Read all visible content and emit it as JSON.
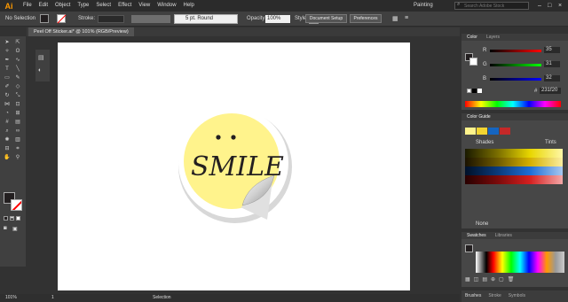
{
  "app": {
    "logo": "Ai",
    "workspace": "Painting",
    "search_placeholder": "Search Adobe Stock"
  },
  "menu": [
    "File",
    "Edit",
    "Object",
    "Type",
    "Select",
    "Effect",
    "View",
    "Window",
    "Help"
  ],
  "control": {
    "selection": "No Selection",
    "stroke_label": "Stroke:",
    "brush": "5 pt. Round",
    "opacity_label": "Opacity:",
    "opacity_value": "100%",
    "style_label": "Style:",
    "doc_setup": "Document Setup",
    "preferences": "Preferences"
  },
  "document": {
    "tab_title": "Peel Off Sticker.ai* @ 101% (RGB/Preview)",
    "artwork_text": "SMILE"
  },
  "color_panel": {
    "tabs": [
      "Color",
      "Layers"
    ],
    "r_label": "R",
    "g_label": "G",
    "b_label": "B",
    "r": "35",
    "g": "31",
    "b": "32",
    "hex": "231f20"
  },
  "color_guide": {
    "title": "Color Guide",
    "shades": "Shades",
    "tints": "Tints",
    "none_label": "None"
  },
  "swatches": {
    "tabs": [
      "Swatches",
      "Libraries"
    ]
  },
  "bottom_tabs": [
    "Brushes",
    "Stroke",
    "Symbols"
  ],
  "status": {
    "zoom": "101%",
    "page": "1",
    "tool": "Selection"
  },
  "colors": {
    "sticker_fill": "#fff38c",
    "accent": "#ff9a00"
  }
}
